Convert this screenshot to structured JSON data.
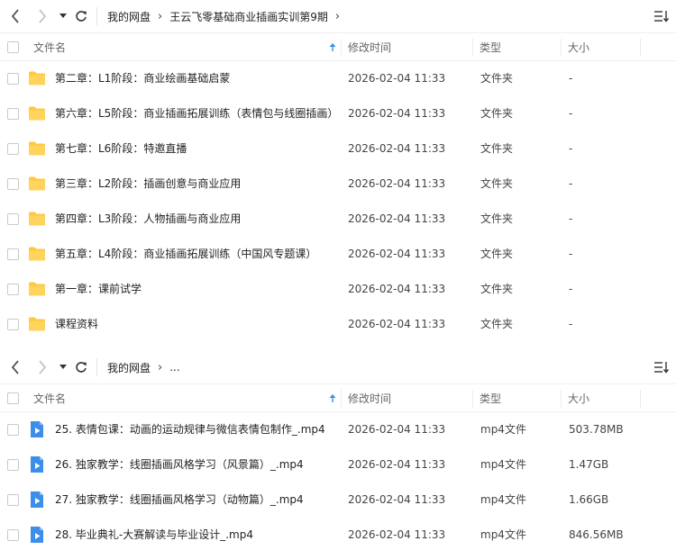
{
  "panels": [
    {
      "breadcrumb": [
        "我的网盘",
        "王云飞零基础商业插画实训第9期"
      ],
      "columns": {
        "name": "文件名",
        "time": "修改时间",
        "type": "类型",
        "size": "大小"
      },
      "rows": [
        {
          "name": "第二章：L1阶段：商业绘画基础启蒙",
          "time": "2026-02-04 11:33",
          "type": "文件夹",
          "size": "-",
          "icon": "folder-icon"
        },
        {
          "name": "第六章：L5阶段：商业插画拓展训练（表情包与线圈插画）",
          "time": "2026-02-04 11:33",
          "type": "文件夹",
          "size": "-",
          "icon": "folder-icon"
        },
        {
          "name": "第七章：L6阶段：特邀直播",
          "time": "2026-02-04 11:33",
          "type": "文件夹",
          "size": "-",
          "icon": "folder-icon"
        },
        {
          "name": "第三章：L2阶段：插画创意与商业应用",
          "time": "2026-02-04 11:33",
          "type": "文件夹",
          "size": "-",
          "icon": "folder-icon"
        },
        {
          "name": "第四章：L3阶段：人物插画与商业应用",
          "time": "2026-02-04 11:33",
          "type": "文件夹",
          "size": "-",
          "icon": "folder-icon"
        },
        {
          "name": "第五章：L4阶段：商业插画拓展训练（中国风专题课）",
          "time": "2026-02-04 11:33",
          "type": "文件夹",
          "size": "-",
          "icon": "folder-icon"
        },
        {
          "name": "第一章：课前试学",
          "time": "2026-02-04 11:33",
          "type": "文件夹",
          "size": "-",
          "icon": "folder-icon"
        },
        {
          "name": "课程资料",
          "time": "2026-02-04 11:33",
          "type": "文件夹",
          "size": "-",
          "icon": "folder-icon"
        }
      ]
    },
    {
      "breadcrumb": [
        "我的网盘",
        "..."
      ],
      "columns": {
        "name": "文件名",
        "time": "修改时间",
        "type": "类型",
        "size": "大小"
      },
      "rows": [
        {
          "name": "25. 表情包课：动画的运动规律与微信表情包制作_.mp4",
          "time": "2026-02-04 11:33",
          "type": "mp4文件",
          "size": "503.78MB",
          "icon": "video-file-icon"
        },
        {
          "name": "26. 独家教学：线圈插画风格学习（风景篇）_.mp4",
          "time": "2026-02-04 11:33",
          "type": "mp4文件",
          "size": "1.47GB",
          "icon": "video-file-icon"
        },
        {
          "name": "27. 独家教学：线圈插画风格学习（动物篇）_.mp4",
          "time": "2026-02-04 11:33",
          "type": "mp4文件",
          "size": "1.66GB",
          "icon": "video-file-icon"
        },
        {
          "name": "28. 毕业典礼-大赛解读与毕业设计_.mp4",
          "time": "2026-02-04 11:33",
          "type": "mp4文件",
          "size": "846.56MB",
          "icon": "video-file-icon"
        }
      ]
    }
  ],
  "colors": {
    "folder": "#ffc93c",
    "video": "#3d8ee8",
    "sort_arrow": "#3d8ee8"
  }
}
